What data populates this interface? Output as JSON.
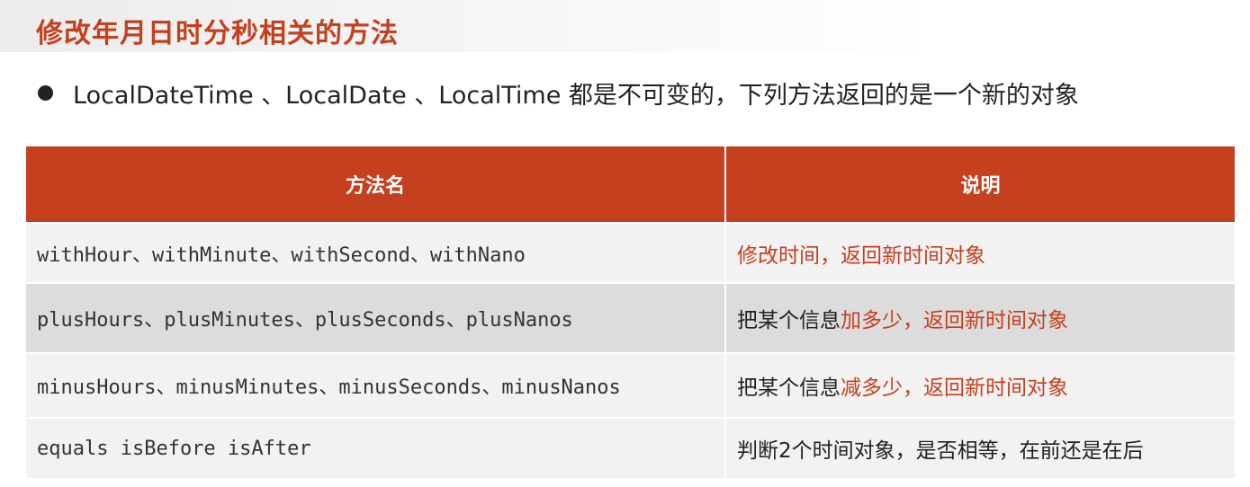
{
  "title": "修改年月日时分秒相关的方法",
  "bullet": "LocalDateTime 、LocalDate 、LocalTime 都是不可变的，下列方法返回的是一个新的对象",
  "table": {
    "headers": [
      "方法名",
      "说明"
    ],
    "rows": [
      {
        "method": "withHour、withMinute、withSecond、withNano",
        "desc_plain": "",
        "desc_accent": "修改时间，返回新时间对象"
      },
      {
        "method": "plusHours、plusMinutes、plusSeconds、plusNanos",
        "desc_plain": "把某个信息",
        "desc_accent": "加多少，返回新时间对象"
      },
      {
        "method": "minusHours、minusMinutes、minusSeconds、minusNanos",
        "desc_plain": "把某个信息",
        "desc_accent": "减多少，返回新时间对象"
      },
      {
        "method": "equals isBefore isAfter",
        "desc_plain": "判断2个时间对象，是否相等，在前还是在后",
        "desc_accent": ""
      }
    ]
  },
  "colors": {
    "accent": "#c4401e",
    "header_bg": "#c4401e",
    "row_odd_bg": "#f2f2f2",
    "row_even_bg": "#dcdcdc"
  }
}
